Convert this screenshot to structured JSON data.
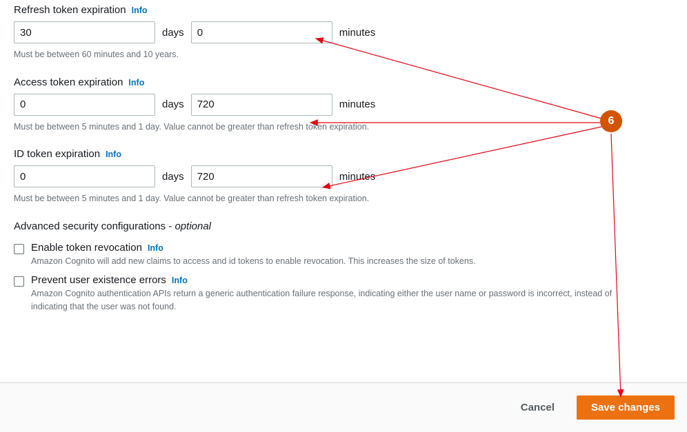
{
  "info_label": "Info",
  "unit_days": "days",
  "unit_minutes": "minutes",
  "refresh": {
    "label": "Refresh token expiration",
    "days": "30",
    "minutes": "0",
    "helper": "Must be between 60 minutes and 10 years."
  },
  "access": {
    "label": "Access token expiration",
    "days": "0",
    "minutes": "720",
    "helper": "Must be between 5 minutes and 1 day. Value cannot be greater than refresh token expiration."
  },
  "idtoken": {
    "label": "ID token expiration",
    "days": "0",
    "minutes": "720",
    "helper": "Must be between 5 minutes and 1 day. Value cannot be greater than refresh token expiration."
  },
  "advanced": {
    "heading": "Advanced security configurations -",
    "optional": "optional",
    "revocation": {
      "label": "Enable token revocation",
      "desc": "Amazon Cognito will add new claims to access and id tokens to enable revocation. This increases the size of tokens."
    },
    "existence": {
      "label": "Prevent user existence errors",
      "desc": "Amazon Cognito authentication APIs return a generic authentication failure response, indicating either the user name or password is incorrect, instead of indicating that the user was not found."
    }
  },
  "footer": {
    "cancel": "Cancel",
    "save": "Save changes"
  },
  "annotation": {
    "badge": "6"
  }
}
